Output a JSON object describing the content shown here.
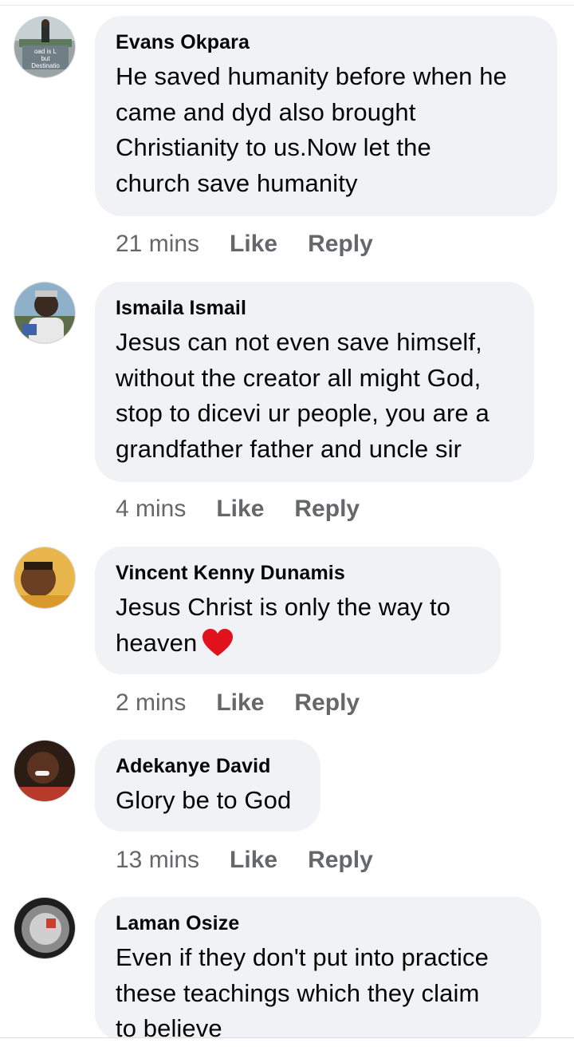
{
  "comments": [
    {
      "author": "Evans Okpara",
      "avatar_icon": "profile-photo-road-sign",
      "avatar_caption": [
        "oad is L",
        "but",
        "Destinatio"
      ],
      "lines": [
        "He saved humanity before when he",
        "came and dyd also brought",
        "Christianity to us.Now let the",
        "church save humanity"
      ],
      "time": "21 mins",
      "like": "Like",
      "reply": "Reply"
    },
    {
      "author": "Ismaila Ismail",
      "avatar_icon": "profile-photo-man-outdoors",
      "lines": [
        "Jesus can not even save himself,",
        "without the creator all might God,",
        "stop to dicevi ur people, you are a",
        "grandfather father and uncle sir"
      ],
      "time": "4 mins",
      "like": "Like",
      "reply": "Reply"
    },
    {
      "author": "Vincent Kenny Dunamis",
      "avatar_icon": "profile-photo-man-yellow-background",
      "lines": [
        "Jesus Christ is only the way to",
        "heaven"
      ],
      "emoji": "red-heart-icon",
      "time": "2 mins",
      "like": "Like",
      "reply": "Reply"
    },
    {
      "author": "Adekanye David",
      "avatar_icon": "profile-photo-smiling-man",
      "lines": [
        "Glory be to God"
      ],
      "time": "13 mins",
      "like": "Like",
      "reply": "Reply"
    },
    {
      "author": "Laman Osize",
      "avatar_icon": "profile-photo-dark-bowl",
      "lines": [
        "Even if they don't put into practice",
        "these teachings which they claim",
        "to believe"
      ]
    }
  ],
  "colors": {
    "bubble": "#f0f2f5",
    "meta_text": "#65676b",
    "author_text": "#050505",
    "heart": "#e0121c"
  }
}
